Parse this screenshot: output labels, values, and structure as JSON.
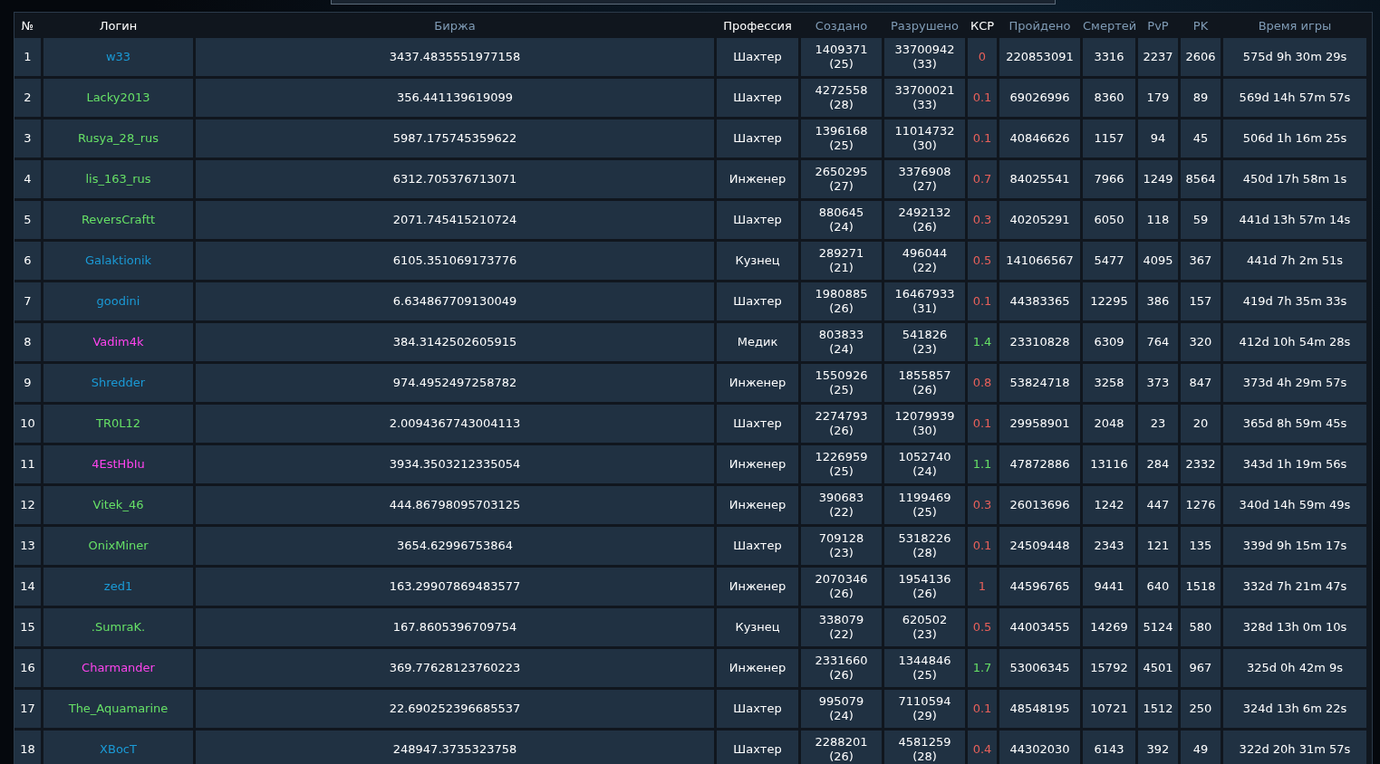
{
  "table": {
    "columns": [
      {
        "label": "№",
        "sortable": false
      },
      {
        "label": "Логин",
        "sortable": false
      },
      {
        "label": "Биржа",
        "sortable": true
      },
      {
        "label": "Профессия",
        "sortable": false
      },
      {
        "label": "Создано",
        "sortable": true
      },
      {
        "label": "Разрушено",
        "sortable": true
      },
      {
        "label": "КСР",
        "sortable": false
      },
      {
        "label": "Пройдено",
        "sortable": true
      },
      {
        "label": "Смертей",
        "sortable": true
      },
      {
        "label": "PvP",
        "sortable": true
      },
      {
        "label": "PK",
        "sortable": true
      },
      {
        "label": "Время игры",
        "sortable": true
      }
    ],
    "rows": [
      {
        "n": "1",
        "login": "w33",
        "color": "#1a9ad6",
        "exchange": "3437.4835551977158",
        "profession": "Шахтер",
        "created": "1409371",
        "created_level": "(25)",
        "destroyed": "33700942",
        "destroyed_level": "(33)",
        "ksr": {
          "text": "0",
          "color": "#e8605a"
        },
        "passed": "220853091",
        "deaths": "3316",
        "pvp": "2237",
        "pk": "2606",
        "time": "575d 9h 30m 29s"
      },
      {
        "n": "2",
        "login": "Lacky2013",
        "color": "#66e066",
        "exchange": "356.441139619099",
        "profession": "Шахтер",
        "created": "4272558",
        "created_level": "(28)",
        "destroyed": "33700021",
        "destroyed_level": "(33)",
        "ksr": {
          "text": "0.1",
          "color": "#e8605a"
        },
        "passed": "69026996",
        "deaths": "8360",
        "pvp": "179",
        "pk": "89",
        "time": "569d 14h 57m 57s"
      },
      {
        "n": "3",
        "login": "Rusya_28_rus",
        "color": "#66e066",
        "exchange": "5987.175745359622",
        "profession": "Шахтер",
        "created": "1396168",
        "created_level": "(25)",
        "destroyed": "11014732",
        "destroyed_level": "(30)",
        "ksr": {
          "text": "0.1",
          "color": "#e8605a"
        },
        "passed": "40846626",
        "deaths": "1157",
        "pvp": "94",
        "pk": "45",
        "time": "506d 1h 16m 25s"
      },
      {
        "n": "4",
        "login": "lis_163_rus",
        "color": "#66e066",
        "exchange": "6312.705376713071",
        "profession": "Инженер",
        "created": "2650295",
        "created_level": "(27)",
        "destroyed": "3376908",
        "destroyed_level": "(27)",
        "ksr": {
          "text": "0.7",
          "color": "#e8605a"
        },
        "passed": "84025541",
        "deaths": "7966",
        "pvp": "1249",
        "pk": "8564",
        "time": "450d 17h 58m 1s"
      },
      {
        "n": "5",
        "login": "ReversCraftt",
        "color": "#66e066",
        "exchange": "2071.745415210724",
        "profession": "Шахтер",
        "created": "880645",
        "created_level": "(24)",
        "destroyed": "2492132",
        "destroyed_level": "(26)",
        "ksr": {
          "text": "0.3",
          "color": "#e8605a"
        },
        "passed": "40205291",
        "deaths": "6050",
        "pvp": "118",
        "pk": "59",
        "time": "441d 13h 57m 14s"
      },
      {
        "n": "6",
        "login": "Galaktionik",
        "color": "#1a9ad6",
        "exchange": "6105.351069173776",
        "profession": "Кузнец",
        "created": "289271",
        "created_level": "(21)",
        "destroyed": "496044",
        "destroyed_level": "(22)",
        "ksr": {
          "text": "0.5",
          "color": "#e8605a"
        },
        "passed": "141066567",
        "deaths": "5477",
        "pvp": "4095",
        "pk": "367",
        "time": "441d 7h 2m 51s"
      },
      {
        "n": "7",
        "login": "goodini",
        "color": "#1a9ad6",
        "exchange": "6.634867709130049",
        "profession": "Шахтер",
        "created": "1980885",
        "created_level": "(26)",
        "destroyed": "16467933",
        "destroyed_level": "(31)",
        "ksr": {
          "text": "0.1",
          "color": "#e8605a"
        },
        "passed": "44383365",
        "deaths": "12295",
        "pvp": "386",
        "pk": "157",
        "time": "419d 7h 35m 33s"
      },
      {
        "n": "8",
        "login": "Vadim4k",
        "color": "#ff44ee",
        "exchange": "384.3142502605915",
        "profession": "Медик",
        "created": "803833",
        "created_level": "(24)",
        "destroyed": "541826",
        "destroyed_level": "(23)",
        "ksr": {
          "text": "1.4",
          "color": "#66e066"
        },
        "passed": "23310828",
        "deaths": "6309",
        "pvp": "764",
        "pk": "320",
        "time": "412d 10h 54m 28s"
      },
      {
        "n": "9",
        "login": "Shredder",
        "color": "#1a9ad6",
        "exchange": "974.4952497258782",
        "profession": "Инженер",
        "created": "1550926",
        "created_level": "(25)",
        "destroyed": "1855857",
        "destroyed_level": "(26)",
        "ksr": {
          "text": "0.8",
          "color": "#e8605a"
        },
        "passed": "53824718",
        "deaths": "3258",
        "pvp": "373",
        "pk": "847",
        "time": "373d 4h 29m 57s"
      },
      {
        "n": "10",
        "login": "TR0L12",
        "color": "#66e066",
        "exchange": "2.0094367743004113",
        "profession": "Шахтер",
        "created": "2274793",
        "created_level": "(26)",
        "destroyed": "12079939",
        "destroyed_level": "(30)",
        "ksr": {
          "text": "0.1",
          "color": "#e8605a"
        },
        "passed": "29958901",
        "deaths": "2048",
        "pvp": "23",
        "pk": "20",
        "time": "365d 8h 59m 45s"
      },
      {
        "n": "11",
        "login": "4EstHbIu",
        "color": "#ff44ee",
        "exchange": "3934.3503212335054",
        "profession": "Инженер",
        "created": "1226959",
        "created_level": "(25)",
        "destroyed": "1052740",
        "destroyed_level": "(24)",
        "ksr": {
          "text": "1.1",
          "color": "#66e066"
        },
        "passed": "47872886",
        "deaths": "13116",
        "pvp": "284",
        "pk": "2332",
        "time": "343d 1h 19m 56s"
      },
      {
        "n": "12",
        "login": "Vitek_46",
        "color": "#66e066",
        "exchange": "444.86798095703125",
        "profession": "Инженер",
        "created": "390683",
        "created_level": "(22)",
        "destroyed": "1199469",
        "destroyed_level": "(25)",
        "ksr": {
          "text": "0.3",
          "color": "#e8605a"
        },
        "passed": "26013696",
        "deaths": "1242",
        "pvp": "447",
        "pk": "1276",
        "time": "340d 14h 59m 49s"
      },
      {
        "n": "13",
        "login": "OnixMiner",
        "color": "#66e066",
        "exchange": "3654.62996753864",
        "profession": "Шахтер",
        "created": "709128",
        "created_level": "(23)",
        "destroyed": "5318226",
        "destroyed_level": "(28)",
        "ksr": {
          "text": "0.1",
          "color": "#e8605a"
        },
        "passed": "24509448",
        "deaths": "2343",
        "pvp": "121",
        "pk": "135",
        "time": "339d 9h 15m 17s"
      },
      {
        "n": "14",
        "login": "zed1",
        "color": "#1a9ad6",
        "exchange": "163.29907869483577",
        "profession": "Инженер",
        "created": "2070346",
        "created_level": "(26)",
        "destroyed": "1954136",
        "destroyed_level": "(26)",
        "ksr": {
          "text": "1",
          "color": "#e8605a"
        },
        "passed": "44596765",
        "deaths": "9441",
        "pvp": "640",
        "pk": "1518",
        "time": "332d 7h 21m 47s"
      },
      {
        "n": "15",
        "login": ".SumraK.",
        "color": "#66e066",
        "exchange": "167.8605396709754",
        "profession": "Кузнец",
        "created": "338079",
        "created_level": "(22)",
        "destroyed": "620502",
        "destroyed_level": "(23)",
        "ksr": {
          "text": "0.5",
          "color": "#e8605a"
        },
        "passed": "44003455",
        "deaths": "14269",
        "pvp": "5124",
        "pk": "580",
        "time": "328d 13h 0m 10s"
      },
      {
        "n": "16",
        "login": "Charmander",
        "color": "#ff44ee",
        "exchange": "369.77628123760223",
        "profession": "Инженер",
        "created": "2331660",
        "created_level": "(26)",
        "destroyed": "1344846",
        "destroyed_level": "(25)",
        "ksr": {
          "text": "1.7",
          "color": "#66e066"
        },
        "passed": "53006345",
        "deaths": "15792",
        "pvp": "4501",
        "pk": "967",
        "time": "325d 0h 42m 9s"
      },
      {
        "n": "17",
        "login": "The_Aquamarine",
        "color": "#66e066",
        "exchange": "22.690252396685537",
        "profession": "Шахтер",
        "created": "995079",
        "created_level": "(24)",
        "destroyed": "7110594",
        "destroyed_level": "(29)",
        "ksr": {
          "text": "0.1",
          "color": "#e8605a"
        },
        "passed": "48548195",
        "deaths": "10721",
        "pvp": "1512",
        "pk": "250",
        "time": "324d 13h 6m 22s"
      },
      {
        "n": "18",
        "login": "XBocT",
        "color": "#1a9ad6",
        "exchange": "248947.3735323758",
        "profession": "Шахтер",
        "created": "2288201",
        "created_level": "(26)",
        "destroyed": "4581259",
        "destroyed_level": "(28)",
        "ksr": {
          "text": "0.4",
          "color": "#e8605a"
        },
        "passed": "44302030",
        "deaths": "6143",
        "pvp": "392",
        "pk": "49",
        "time": "322d 20h 31m 57s"
      }
    ]
  }
}
